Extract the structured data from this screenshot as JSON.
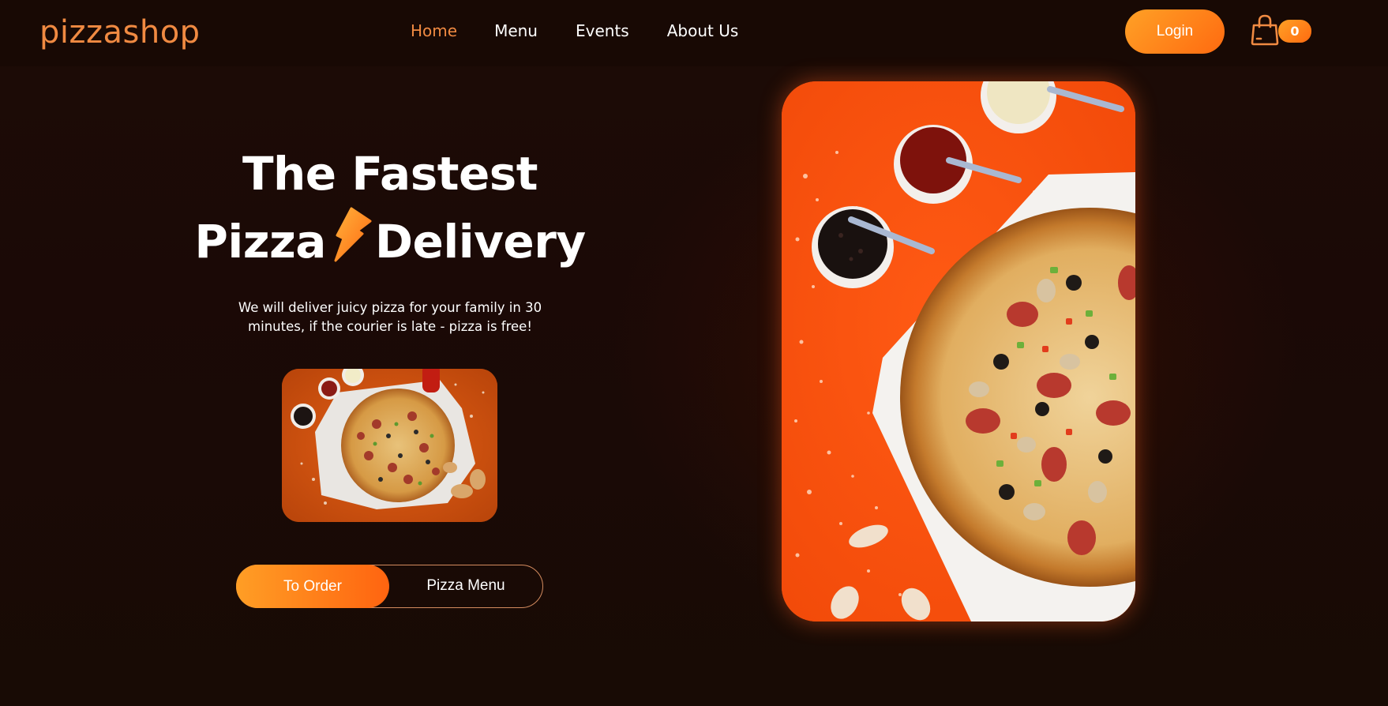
{
  "brand": {
    "logo": "pizzashop",
    "accent": "#f08a42",
    "gradient_start": "#ffa126",
    "gradient_end": "#ff6a10"
  },
  "nav": {
    "items": [
      {
        "label": "Home",
        "active": true
      },
      {
        "label": "Menu",
        "active": false
      },
      {
        "label": "Events",
        "active": false
      },
      {
        "label": "About Us",
        "active": false
      }
    ]
  },
  "header": {
    "login_label": "Login",
    "cart_icon": "shopping-bag-icon",
    "cart_count": "0"
  },
  "hero": {
    "title_line1": "The Fastest",
    "title_word_pizza": "Pizza",
    "title_word_delivery": "Delivery",
    "title_icon": "lightning-bolt-icon",
    "description": "We will deliver juicy pizza for your family in 30 minutes, if the courier is late - pizza is free!",
    "order_button": "To Order",
    "menu_button": "Pizza Menu",
    "thumbnail": "pizza-photo-thumbnail",
    "main_image": "pizza-photo-main"
  }
}
